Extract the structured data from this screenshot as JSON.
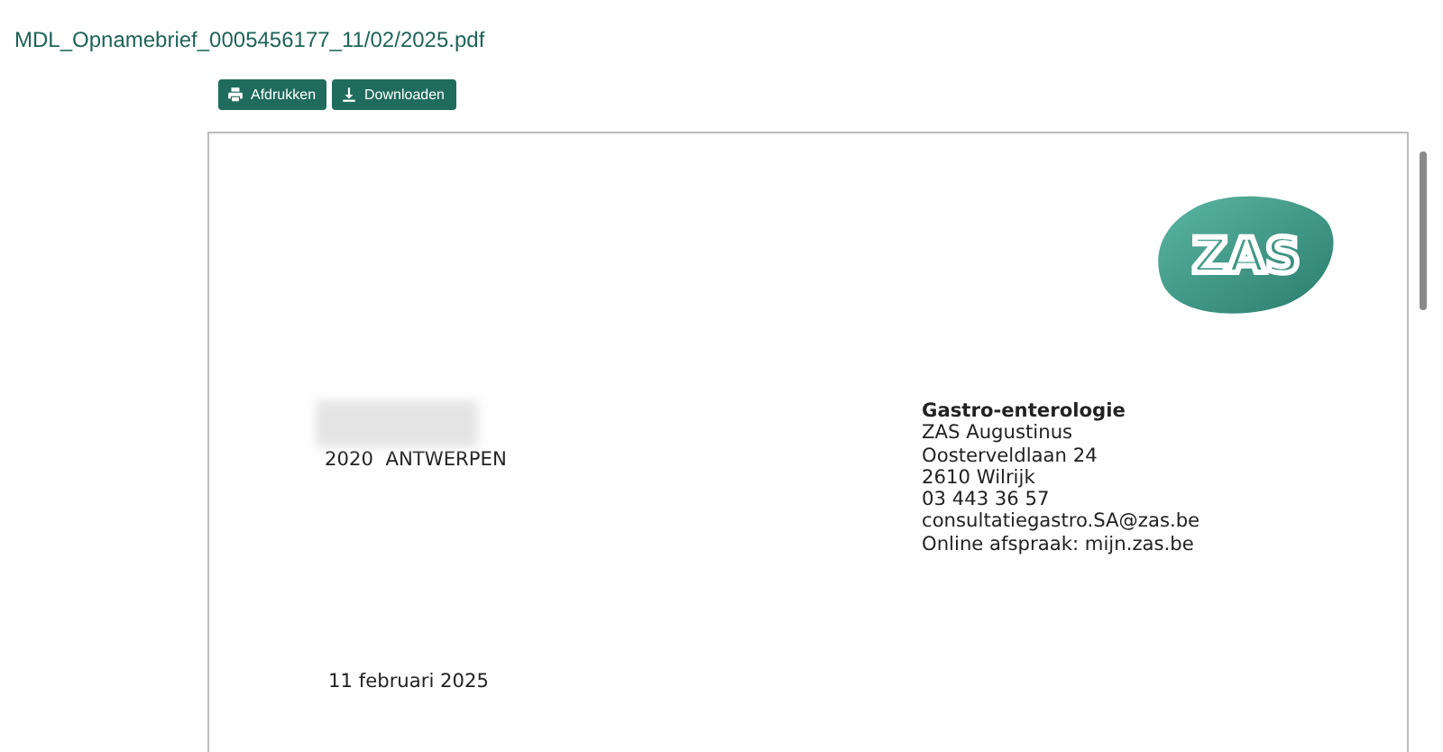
{
  "title": "MDL_Opnamebrief_0005456177_11/02/2025.pdf",
  "buttons": [
    {
      "kind": "print",
      "label": "Afdrukken"
    },
    {
      "kind": "download",
      "label": "Downloaden"
    }
  ],
  "document": {
    "logo": "ZAS",
    "recipient": {
      "city_line": "2020  ANTWERPEN"
    },
    "sender": {
      "department": "Gastro-enterologie",
      "lines": [
        "ZAS Augustinus",
        "Oosterveldlaan 24",
        "2610 Wilrijk",
        "03 443 36 57",
        "consultatiegastro.SA@zas.be",
        "Online afspraak: mijn.zas.be"
      ]
    },
    "date": "11 februari 2025"
  }
}
